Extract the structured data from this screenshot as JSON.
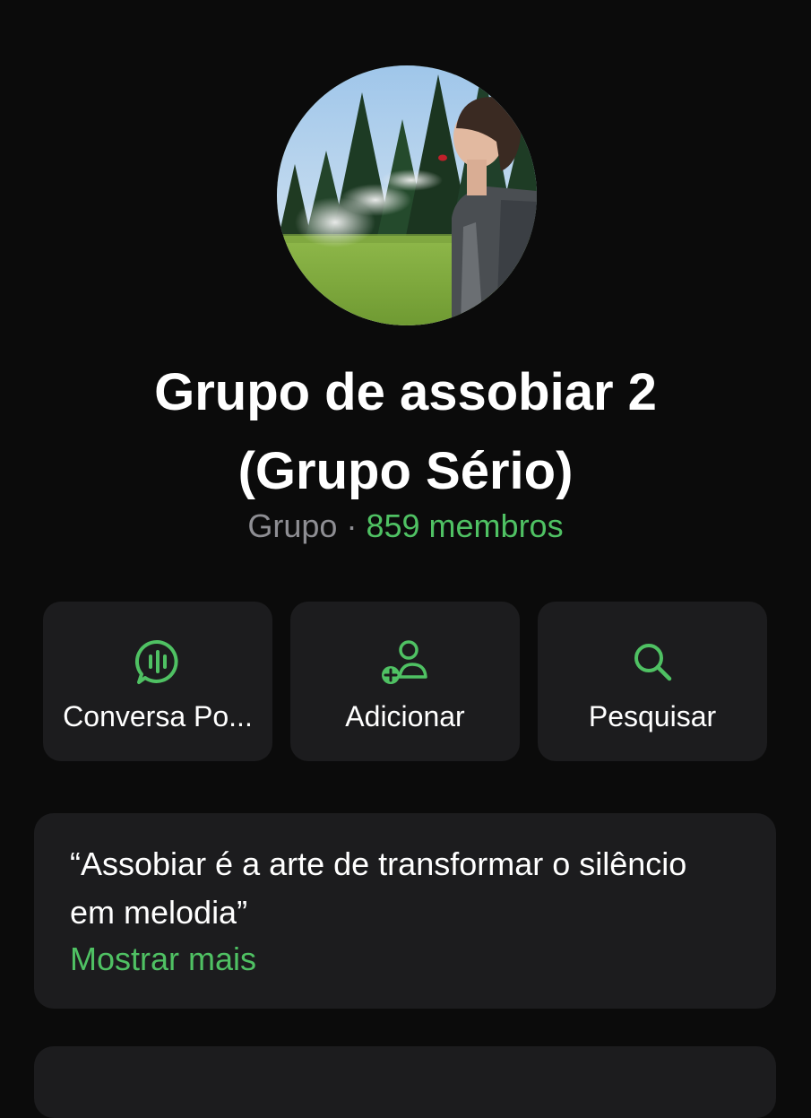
{
  "group": {
    "title_line1": "Grupo de assobiar 2",
    "title_line2": "(Grupo Sério)",
    "kind": "Grupo",
    "separator": "·",
    "members": "859 membros"
  },
  "actions": [
    {
      "label": "Conversa Po...",
      "icon": "voice-chat-icon"
    },
    {
      "label": "Adicionar",
      "icon": "add-person-icon"
    },
    {
      "label": "Pesquisar",
      "icon": "search-icon"
    }
  ],
  "description": {
    "text": "“Assobiar é a arte de transformar o silêncio em melodia”",
    "show_more": "Mostrar mais"
  },
  "colors": {
    "background": "#0b0b0b",
    "card": "#1c1c1e",
    "accent": "#4fc163",
    "secondary_text": "#8e8e93"
  }
}
